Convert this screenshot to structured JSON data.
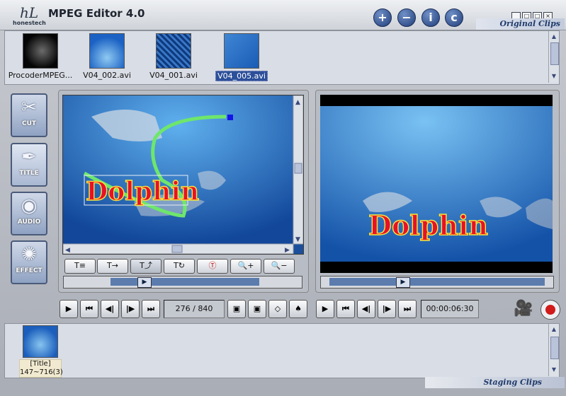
{
  "app": {
    "brand_logo_text": "hL",
    "brand_name": "honestech",
    "title": "MPEG Editor 4.0",
    "header_buttons": {
      "add": "+",
      "remove": "−",
      "info": "i",
      "copyright": "c"
    },
    "window_controls": {
      "minimize": "_",
      "restore": "□",
      "maximize": "□",
      "close": "×"
    }
  },
  "original_clips": {
    "section_label": "Original Clips",
    "items": [
      {
        "label": "ProcoderMPEG...",
        "selected": false
      },
      {
        "label": "V04_002.avi",
        "selected": false
      },
      {
        "label": "V04_001.avi",
        "selected": false
      },
      {
        "label": "V04_005.avi",
        "selected": true
      }
    ]
  },
  "tools": [
    {
      "label": "CUT",
      "icon": "scissors-icon"
    },
    {
      "label": "TITLE",
      "icon": "pen-nib-icon"
    },
    {
      "label": "AUDIO",
      "icon": "sound-waves-icon"
    },
    {
      "label": "EFFECT",
      "icon": "swirl-icon"
    }
  ],
  "editor": {
    "title_text": "Dolphin",
    "effect_buttons": [
      "T≡",
      "T→",
      "T⤴",
      "T↻",
      "Ⓣ",
      "🔍+",
      "🔍−"
    ],
    "position_fraction": 0.31
  },
  "preview": {
    "title_text": "Dolphin",
    "position_fraction": 0.35
  },
  "transport": {
    "left": {
      "play": "▶",
      "prev": "⏮",
      "step_back": "◀|",
      "step_fwd": "|▶",
      "next": "⏭"
    },
    "frame_counter": "276 / 840",
    "tool_icons": [
      "mark-in-icon",
      "mark-out-icon",
      "eraser-icon",
      "ink-icon"
    ],
    "right": {
      "play": "▶",
      "prev": "⏮",
      "step_back": "◀|",
      "step_fwd": "|▶",
      "next": "⏭"
    },
    "timecode": "00:00:06:30"
  },
  "staging_clips": {
    "section_label": "Staging Clips",
    "items": [
      {
        "label_line1": "[Title]",
        "label_line2": "147~716(3)"
      }
    ]
  },
  "colors": {
    "accent": "#213e7a",
    "title_fill": "#e8102a",
    "title_outline": "#f5e63c",
    "motion_path": "#6ee66c"
  }
}
